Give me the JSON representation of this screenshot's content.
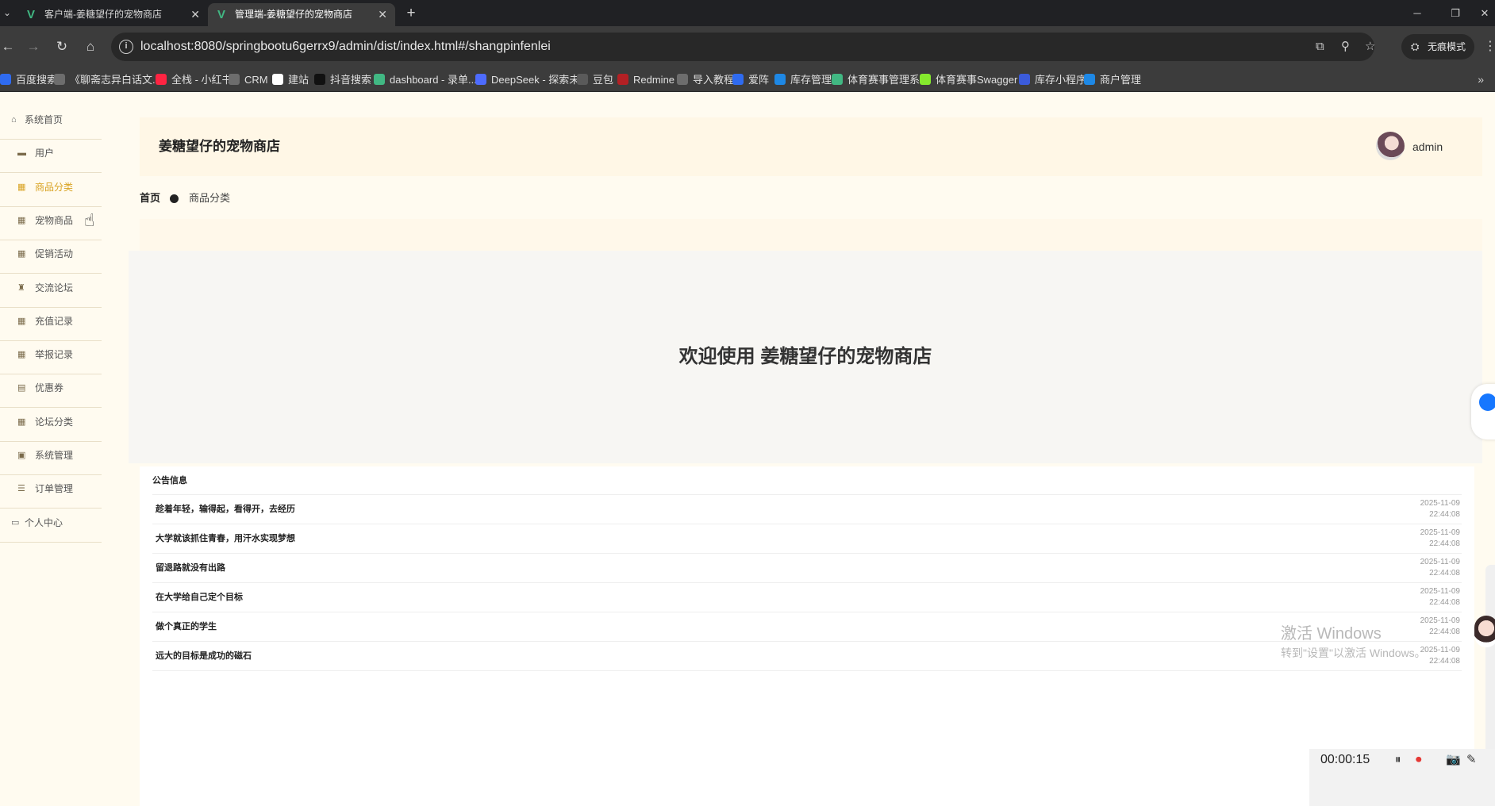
{
  "browser": {
    "tabs": [
      {
        "title": "客户端-姜糖望仔的宠物商店",
        "active": false
      },
      {
        "title": "管理端-姜糖望仔的宠物商店",
        "active": true
      }
    ],
    "url": "localhost:8080/springbootu6gerrx9/admin/dist/index.html#/shangpinfenlei",
    "incognito_label": "无痕模式",
    "bookmarks": [
      {
        "label": "百度搜索",
        "color": "#2f6bf0"
      },
      {
        "label": "《聊斋志异白话文...",
        "color": "#6d6d6d"
      },
      {
        "label": "全栈 - 小红书",
        "color": "#ff2442"
      },
      {
        "label": "CRM",
        "color": "#6d6d6d"
      },
      {
        "label": "建站",
        "color": "#ffffff"
      },
      {
        "label": "抖音搜索",
        "color": "#111111"
      },
      {
        "label": "dashboard - 录单...",
        "color": "#41b883"
      },
      {
        "label": "DeepSeek - 探索未...",
        "color": "#4d6bfe"
      },
      {
        "label": "豆包",
        "color": "#5a5a5a"
      },
      {
        "label": "Redmine",
        "color": "#b32024"
      },
      {
        "label": "导入教程",
        "color": "#6d6d6d"
      },
      {
        "label": "爱阵",
        "color": "#2f6bf0"
      },
      {
        "label": "库存管理",
        "color": "#1e88e5"
      },
      {
        "label": "体育赛事管理系统",
        "color": "#41b883"
      },
      {
        "label": "体育赛事Swagger UI",
        "color": "#85ea2d"
      },
      {
        "label": "库存小程序",
        "color": "#3b5bdb"
      },
      {
        "label": "商户管理",
        "color": "#1e88e5"
      }
    ]
  },
  "sidebar": {
    "items": [
      {
        "label": "系统首页",
        "icon": "home-icon",
        "level": "top"
      },
      {
        "label": "用户",
        "icon": "folder-icon",
        "level": "sub"
      },
      {
        "label": "商品分类",
        "icon": "grid-icon",
        "level": "sub",
        "active": true
      },
      {
        "label": "宠物商品",
        "icon": "grid-icon",
        "level": "sub"
      },
      {
        "label": "促销活动",
        "icon": "grid-icon",
        "level": "sub"
      },
      {
        "label": "交流论坛",
        "icon": "trophy-icon",
        "level": "sub"
      },
      {
        "label": "充值记录",
        "icon": "grid-icon",
        "level": "sub"
      },
      {
        "label": "举报记录",
        "icon": "grid-icon",
        "level": "sub"
      },
      {
        "label": "优惠券",
        "icon": "clipboard-icon",
        "level": "sub"
      },
      {
        "label": "论坛分类",
        "icon": "grid-icon",
        "level": "sub"
      },
      {
        "label": "系统管理",
        "icon": "clipboard-check-icon",
        "level": "sub"
      },
      {
        "label": "订单管理",
        "icon": "list-icon",
        "level": "sub"
      },
      {
        "label": "个人中心",
        "icon": "profile-icon",
        "level": "top"
      }
    ],
    "accent": "#d9a322"
  },
  "header": {
    "title": "姜糖望仔的宠物商店",
    "username": "admin"
  },
  "breadcrumb": {
    "home": "首页",
    "current": "商品分类"
  },
  "welcome": {
    "text": "欢迎使用 姜糖望仔的宠物商店"
  },
  "notice": {
    "title": "公告信息",
    "items": [
      {
        "title": "趁着年轻，输得起，看得开，去经历",
        "date": "2025-11-09",
        "time": "22:44:08"
      },
      {
        "title": "大学就该抓住青春，用汗水实现梦想",
        "date": "2025-11-09",
        "time": "22:44:08"
      },
      {
        "title": "留退路就没有出路",
        "date": "2025-11-09",
        "time": "22:44:08"
      },
      {
        "title": "在大学给自己定个目标",
        "date": "2025-11-09",
        "time": "22:44:08"
      },
      {
        "title": "做个真正的学生",
        "date": "2025-11-09",
        "time": "22:44:08"
      },
      {
        "title": "远大的目标是成功的磁石",
        "date": "2025-11-09",
        "time": "22:44:08"
      }
    ]
  },
  "overlays": {
    "activate_line1": "激活 Windows",
    "activate_line2": "转到\"设置\"以激活 Windows。",
    "recording_time": "00:00:15"
  }
}
